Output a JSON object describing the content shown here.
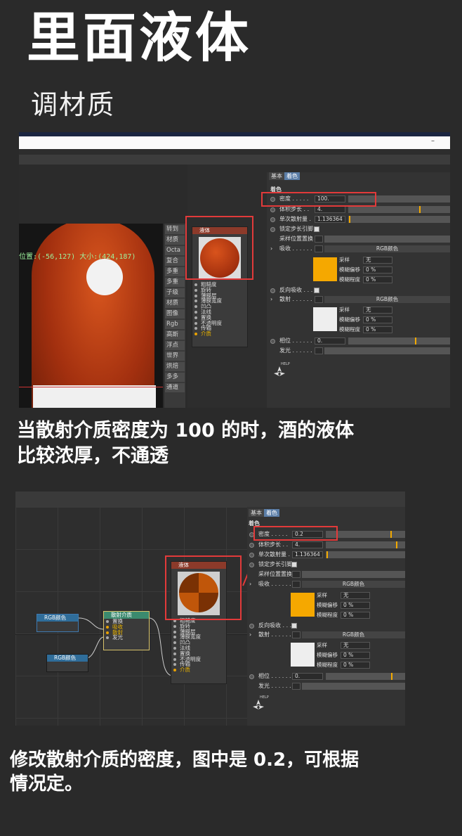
{
  "title": "里面液体",
  "subtitle": "调材质",
  "caption1_line1": "当散射介质密度为 100 的时，酒的液体",
  "caption1_line2": "比较浓厚，不通透",
  "caption2_line1": "修改散射介质的密度，图中是 0.2，可根据",
  "caption2_line2": "情况定。",
  "viewport": {
    "coords": "位置:(-56,127) 大小:(424,187)"
  },
  "sidemenu": [
    "转到",
    "材质",
    "Octa",
    "复合",
    "多重",
    "多重",
    "子级",
    "材质",
    "图像",
    "Rgb",
    "高斯",
    "浮点",
    "世界",
    "烘焙",
    "多多",
    "通道"
  ],
  "node_liquid": {
    "title": "液体",
    "rows": [
      "粗糙度",
      "旋转",
      "薄膜层",
      "薄膜宽度",
      "凹凸",
      "法线",
      "置换",
      "不透明度",
      "传输",
      "介质"
    ]
  },
  "node_scatter": {
    "title": "散射介质",
    "rows": [
      "置换",
      "吸收",
      "散射",
      "发光"
    ]
  },
  "node_rgb": {
    "title": "RGB颜色"
  },
  "panel": {
    "tab_basic": "基本",
    "tab_shading": "着色",
    "section": "着色",
    "density_label": "密度 . . . . .",
    "density_value_1": "100.",
    "density_value_2": "0.2",
    "volume_step_label": "体积步长 . .",
    "volume_step_value": "4.",
    "single_scatter_label": "单次散射量 .",
    "single_scatter_value": "1.136364",
    "lock_step_label": "锁定步长引脚",
    "sample_pos_label": "采样位置置换",
    "absorb_label": "吸收 . . . . . .",
    "rgb_color": "RGB颜色",
    "sample_label": "采样",
    "sample_value": "无",
    "blur_offset_label": "模糊偏移",
    "blur_offset_value": "0 %",
    "blur_level_label": "模糊程度",
    "blur_level_value": "0 %",
    "invert_absorb_label": "反向吸收 . . .",
    "scatter_label": "散射 . . . . . .",
    "phase_label": "相位 . . . . . .",
    "phase_value": "0.",
    "emission_label": "发光 . . . . . .",
    "help_label": "HELP"
  },
  "colors": {
    "absorb_swatch": "#f5a800",
    "scatter_swatch": "#eeeeee",
    "highlight": "#e23a3a",
    "accent_bar": "#f2a900"
  }
}
